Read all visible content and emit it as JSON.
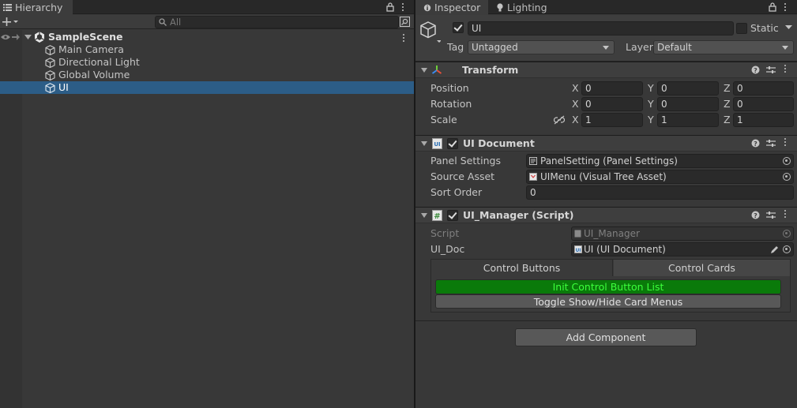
{
  "hierarchy": {
    "tab_label": "Hierarchy",
    "search_placeholder": "All",
    "scene_name": "SampleScene",
    "items": [
      {
        "label": "Main Camera"
      },
      {
        "label": "Directional Light"
      },
      {
        "label": "Global Volume"
      },
      {
        "label": "UI"
      }
    ]
  },
  "inspector": {
    "tab_label": "Inspector",
    "lighting_tab_label": "Lighting",
    "object_name": "UI",
    "static_label": "Static",
    "tag_label": "Tag",
    "tag_value": "Untagged",
    "layer_label": "Layer",
    "layer_value": "Default",
    "transform": {
      "title": "Transform",
      "position_label": "Position",
      "rotation_label": "Rotation",
      "scale_label": "Scale",
      "axis_x": "X",
      "axis_y": "Y",
      "axis_z": "Z",
      "position": [
        "0",
        "0",
        "0"
      ],
      "rotation": [
        "0",
        "0",
        "0"
      ],
      "scale": [
        "1",
        "1",
        "1"
      ]
    },
    "ui_document": {
      "title": "UI Document",
      "panel_settings_label": "Panel Settings",
      "panel_settings_value": "PanelSetting (Panel Settings)",
      "source_asset_label": "Source Asset",
      "source_asset_value": "UIMenu (Visual Tree Asset)",
      "sort_order_label": "Sort Order",
      "sort_order_value": "0"
    },
    "ui_manager": {
      "title": "UI_Manager (Script)",
      "script_label": "Script",
      "script_value": "UI_Manager",
      "ui_doc_label": "UI_Doc",
      "ui_doc_value": "UI (UI Document)",
      "tab_control_buttons": "Control Buttons",
      "tab_control_cards": "Control Cards",
      "init_button": "Init Control Button List",
      "toggle_button": "Toggle Show/Hide Card Menus"
    },
    "add_component_label": "Add Component"
  },
  "colors": {
    "selection": "#2c5d87",
    "init_button_bg": "#0a7a0a",
    "init_button_text": "#3cff3c"
  }
}
